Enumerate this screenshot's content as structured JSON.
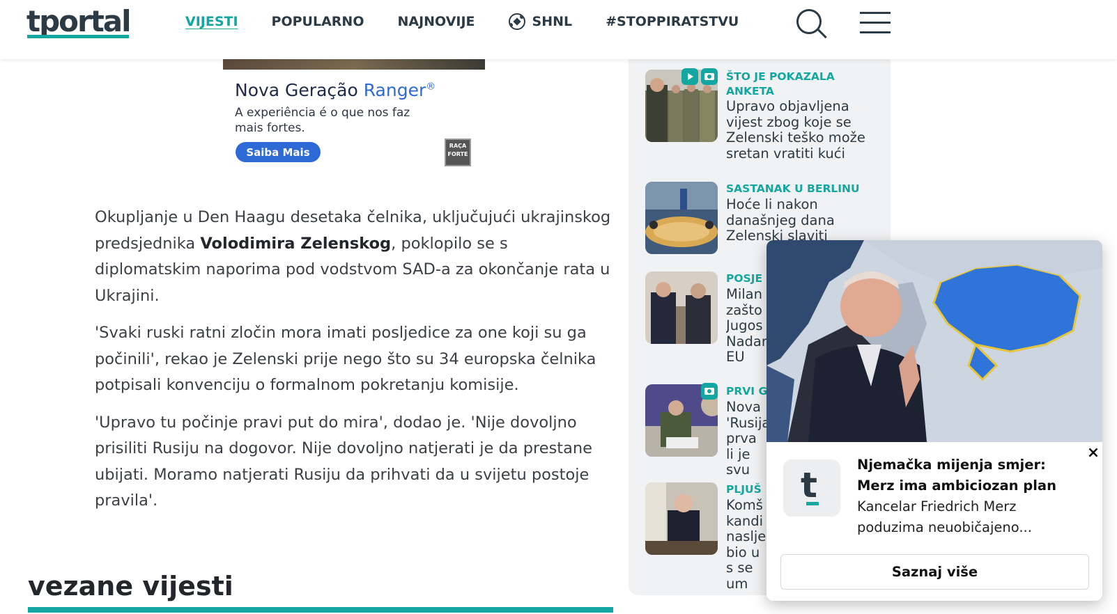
{
  "header": {
    "logo": "tportal",
    "nav": [
      {
        "label": "VIJESTI",
        "active": true
      },
      {
        "label": "POPULARNO",
        "active": false
      },
      {
        "label": "NAJNOVIJE",
        "active": false
      },
      {
        "label": "SHNL",
        "icon": "football-icon",
        "active": false
      },
      {
        "label": "#STOPPIRATSTVU",
        "active": false
      }
    ],
    "icons": [
      "search-icon",
      "hamburger-menu-icon"
    ]
  },
  "ad": {
    "title_prefix": "Nova Geração ",
    "title_brand": "Ranger",
    "title_suffix": "®",
    "subtitle": "A experiência é o que nos faz mais fortes.",
    "button": "Saiba Mais",
    "badge": "RAÇA FORTE"
  },
  "article": {
    "p1_a": "Okupljanje u Den Haagu desetaka čelnika, uključujući ukrajinskog predsjednika ",
    "p1_bold": "Volodimira Zelenskog",
    "p1_b": ", poklopilo se s diplomatskim naporima pod vodstvom SAD-a za okončanje rata u Ukrajini.",
    "p2": "'Svaki ruski ratni zločin mora imati posljedice za one koji su ga počinili', rekao je Zelenski prije nego što su 34 europska čelnika potpisali konvenciju o formalnom pokretanju komisije.",
    "p3": "'Upravo tu počinje pravi put do mira', dodao je. 'Nije dovoljno prisiliti Rusiju na dogovor. Nije dovoljno natjerati je da prestane ubijati. Moramo natjerati Rusiju da prihvati da u svijetu postoje pravila'."
  },
  "related": {
    "title": "vezane vijesti"
  },
  "sidebar": {
    "items": [
      {
        "kicker": "ŠTO JE POKAZALA ANKETA",
        "title": "Upravo objavljena vijest zbog koje se Zelenski teško može sretan vratiti kući"
      },
      {
        "kicker": "SASTANAK U BERLINU",
        "title": "Hoće li nakon današnjeg dana Zelenski slaviti"
      },
      {
        "kicker": "POSJE",
        "title": "Milan zašto Jugos Nadar EU"
      },
      {
        "kicker": "PRVI G",
        "title": "Nova 'Rusija prva li je svu"
      },
      {
        "kicker": "PLJUŠ",
        "title": "Komš kandi nasljed bio u s se um"
      }
    ]
  },
  "popup": {
    "headline": "Njemačka mijenja smjer: Merz ima ambiciozan plan",
    "description": "Kancelar Friedrich Merz poduzima neuobičajeno...",
    "logo_letter": "t",
    "button": "Saznaj više",
    "close": "×"
  },
  "colors": {
    "accent": "#14a6a1",
    "text_dark": "#2b3a44",
    "ad_blue": "#2e6ad6"
  }
}
